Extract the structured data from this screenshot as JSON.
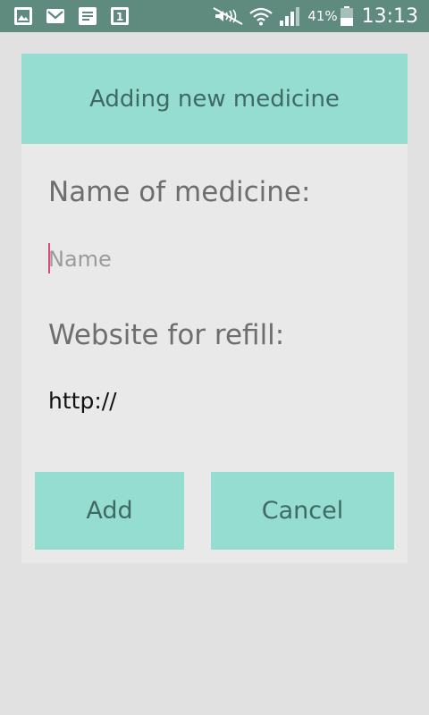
{
  "status_bar": {
    "notification_icons": [
      "gallery-icon",
      "mail-icon",
      "document-icon",
      "calendar-icon"
    ],
    "calendar_day": "1",
    "system_icons": [
      "mute-icon",
      "wifi-icon",
      "signal-icon",
      "battery-icon"
    ],
    "battery_percent": "41%",
    "time": "13:13"
  },
  "dialog": {
    "title": "Adding new medicine",
    "name_label": "Name of medicine:",
    "name_placeholder": "Name",
    "name_value": "",
    "website_label": "Website for refill:",
    "website_value": "http://",
    "add_label": "Add",
    "cancel_label": "Cancel"
  },
  "colors": {
    "status_bar": "#5e8b7e",
    "accent": "#94ddd0",
    "accent_text": "#3f6a63",
    "dialog_bg": "#e9e9e9",
    "screen_bg": "#e1e1e1",
    "cursor": "#e0457b"
  }
}
